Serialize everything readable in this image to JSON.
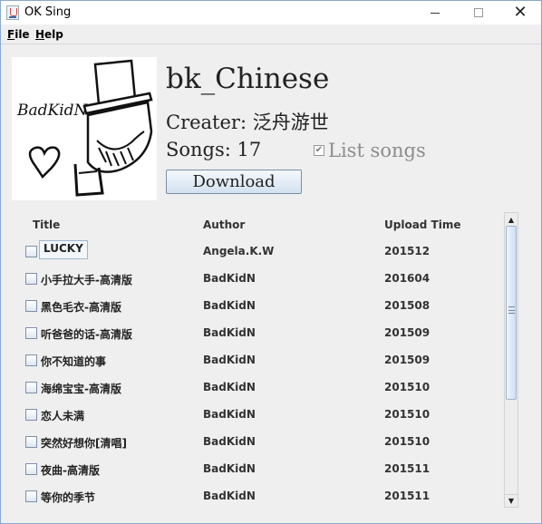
{
  "window": {
    "title": "OK Sing",
    "controls": {
      "minimize": "minimize-icon",
      "maximize": "maximize-icon",
      "close": "✕"
    }
  },
  "menu": {
    "file": {
      "mnemonic": "F",
      "rest": "ile"
    },
    "help": {
      "mnemonic": "H",
      "rest": "elp"
    }
  },
  "playlist": {
    "name": "bk_Chinese",
    "creator": "Creater: 泛舟游世",
    "songs": "Songs: 17",
    "list_songs_label": "List songs",
    "list_songs_checked": true,
    "download_label": "Download",
    "cover_text": "BadKidN"
  },
  "table": {
    "columns": {
      "title": "Title",
      "author": "Author",
      "upload": "Upload Time"
    },
    "rows": [
      {
        "title": "LUCKY",
        "author": "Angela.K.W",
        "upload": "201512"
      },
      {
        "title": "小手拉大手-高清版",
        "author": "BadKidN",
        "upload": "201604"
      },
      {
        "title": "黑色毛衣-高清版",
        "author": "BadKidN",
        "upload": "201508"
      },
      {
        "title": "听爸爸的话-高清版",
        "author": "BadKidN",
        "upload": "201509"
      },
      {
        "title": "你不知道的事",
        "author": "BadKidN",
        "upload": "201509"
      },
      {
        "title": "海绵宝宝-高清版",
        "author": "BadKidN",
        "upload": "201510"
      },
      {
        "title": "恋人未满",
        "author": "BadKidN",
        "upload": "201510"
      },
      {
        "title": "突然好想你[清唱]",
        "author": "BadKidN",
        "upload": "201510"
      },
      {
        "title": "夜曲-高清版",
        "author": "BadKidN",
        "upload": "201511"
      },
      {
        "title": "等你的季节",
        "author": "BadKidN",
        "upload": "201511"
      }
    ]
  },
  "scrollbar": {
    "up": "▲",
    "down": "▼"
  }
}
